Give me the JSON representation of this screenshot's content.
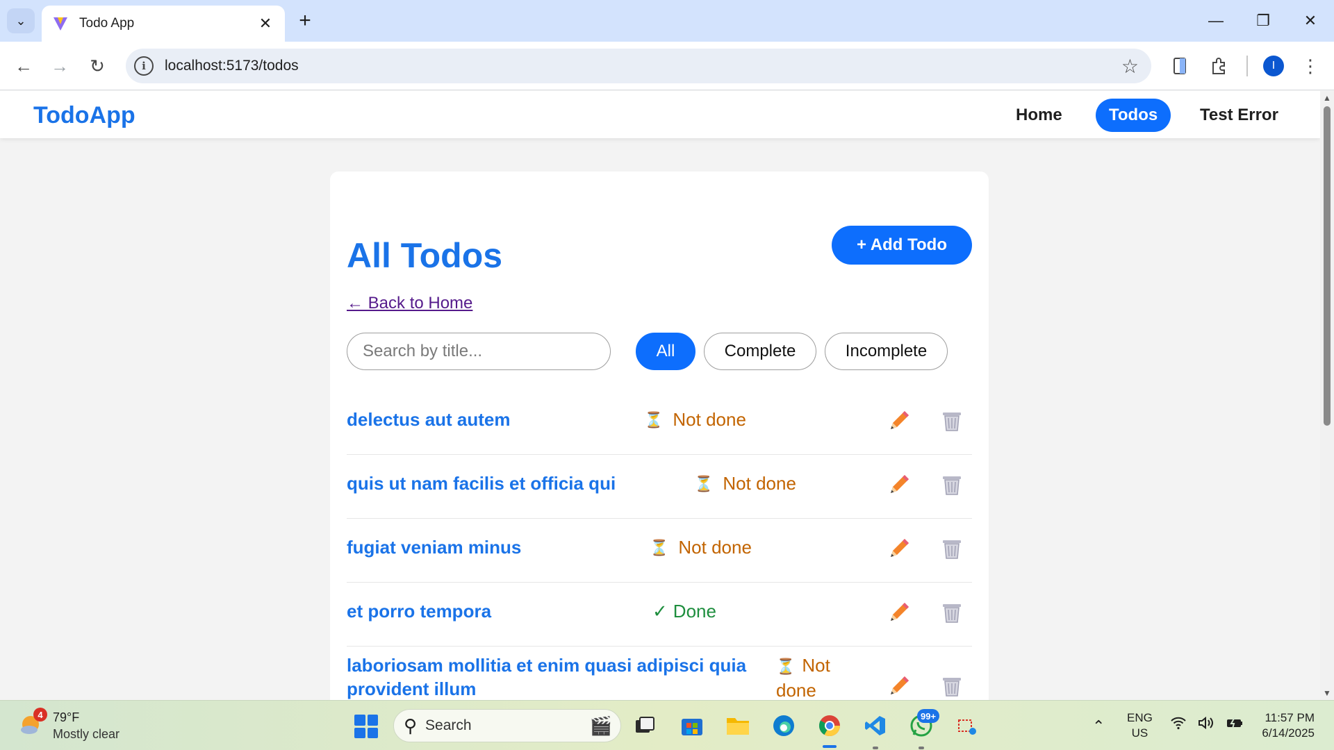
{
  "browser": {
    "tab_title": "Todo App",
    "url": "localhost:5173/todos",
    "profile_initial": "I"
  },
  "app": {
    "brand": "TodoApp",
    "nav": [
      {
        "label": "Home",
        "active": false
      },
      {
        "label": "Todos",
        "active": true
      },
      {
        "label": "Test Error",
        "active": false
      }
    ]
  },
  "page": {
    "title": "All Todos",
    "add_button": "+ Add Todo",
    "back_link": "← Back to Home",
    "search_placeholder": "Search by title...",
    "filters": [
      {
        "label": "All",
        "active": true
      },
      {
        "label": "Complete",
        "active": false
      },
      {
        "label": "Incomplete",
        "active": false
      }
    ],
    "todos": [
      {
        "title": "delectus aut autem",
        "status": "Not done",
        "done": false
      },
      {
        "title": "quis ut nam facilis et officia qui",
        "status": "Not done",
        "done": false
      },
      {
        "title": "fugiat veniam minus",
        "status": "Not done",
        "done": false
      },
      {
        "title": "et porro tempora",
        "status": "Done",
        "done": true
      },
      {
        "title": "laboriosam mollitia et enim quasi adipisci quia provident illum",
        "status": "Not done",
        "done": false
      }
    ]
  },
  "taskbar": {
    "weather_temp": "79°F",
    "weather_desc": "Mostly clear",
    "weather_badge": "4",
    "search_label": "Search",
    "whatsapp_badge": "99+",
    "lang_line1": "ENG",
    "lang_line2": "US",
    "time": "11:57 PM",
    "date": "6/14/2025"
  },
  "colors": {
    "brand": "#1a73e8",
    "primary": "#0d6efd",
    "not_done": "#c26400",
    "done": "#1e8e3e"
  }
}
